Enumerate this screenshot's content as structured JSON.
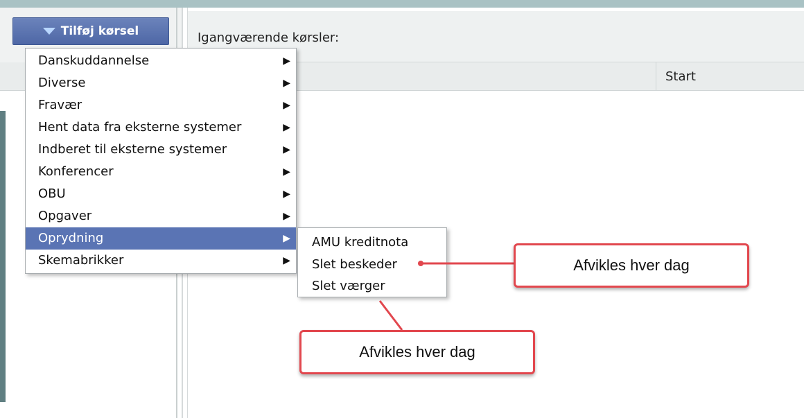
{
  "toolbar": {
    "add_button_label": "Tilføj kørsel",
    "add_button_icon": "triangle-down-icon"
  },
  "main": {
    "title": "Igangværende kørsler:",
    "columns": [
      {
        "label": "Start"
      }
    ]
  },
  "menu": {
    "items": [
      {
        "label": "Danskuddannelse",
        "arrow": "▶"
      },
      {
        "label": "Diverse",
        "arrow": "▶"
      },
      {
        "label": "Fravær",
        "arrow": "▶"
      },
      {
        "label": "Hent data fra eksterne systemer",
        "arrow": "▶"
      },
      {
        "label": "Indberet til eksterne systemer",
        "arrow": "▶"
      },
      {
        "label": "Konferencer",
        "arrow": "▶"
      },
      {
        "label": "OBU",
        "arrow": "▶"
      },
      {
        "label": "Opgaver",
        "arrow": "▶"
      },
      {
        "label": "Oprydning",
        "arrow": "▶",
        "active": true
      },
      {
        "label": "Skemabrikker",
        "arrow": "▶"
      }
    ]
  },
  "submenu": {
    "items": [
      {
        "label": "AMU kreditnota"
      },
      {
        "label": "Slet beskeder"
      },
      {
        "label": "Slet værger"
      }
    ]
  },
  "callouts": [
    {
      "text": "Afvikles hver dag"
    },
    {
      "text": "Afvikles hver dag"
    }
  ],
  "colors": {
    "accent": "#5a74b4",
    "callout_border": "#e2474e"
  }
}
